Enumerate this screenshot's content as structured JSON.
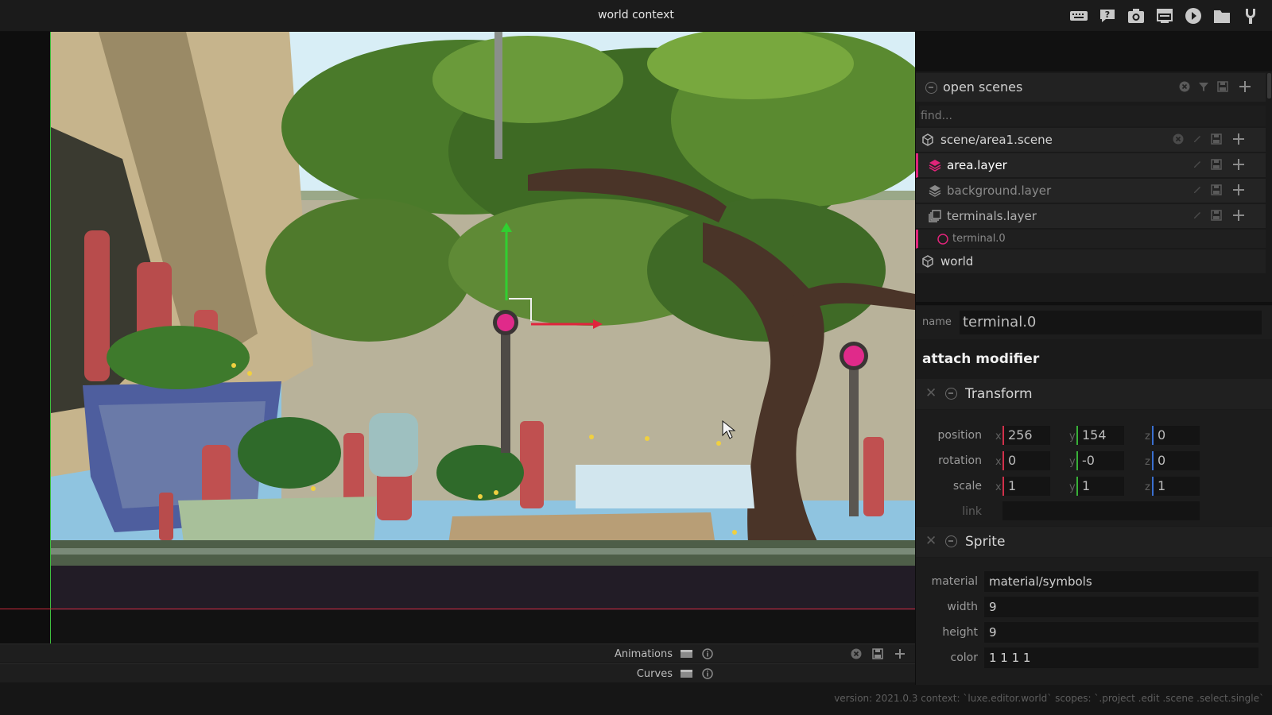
{
  "window": {
    "title": "world context"
  },
  "toolbar": {
    "icons": [
      "keyboard-icon",
      "help-icon",
      "camera-icon",
      "monitor-icon",
      "play-icon",
      "folder-icon",
      "settings-icon"
    ]
  },
  "open_scenes": {
    "title": "open scenes",
    "find_placeholder": "find...",
    "items": [
      {
        "label": "scene/area1.scene",
        "icon": "cube-icon"
      },
      {
        "label": "area.layer",
        "icon": "layers-icon"
      },
      {
        "label": "background.layer",
        "icon": "layers-icon"
      },
      {
        "label": "terminals.layer",
        "icon": "layers-icon"
      },
      {
        "label": "terminal.0",
        "icon": "circle-icon"
      },
      {
        "label": "world",
        "icon": "cube-icon"
      }
    ]
  },
  "inspector": {
    "name_label": "name",
    "name_value": "terminal.0",
    "attach_modifier": "attach modifier",
    "transform": {
      "title": "Transform",
      "position_label": "position",
      "rotation_label": "rotation",
      "scale_label": "scale",
      "link_label": "link",
      "axis_x": "x",
      "axis_y": "y",
      "axis_z": "z",
      "position": {
        "x": "256",
        "y": "154",
        "z": "0"
      },
      "rotation": {
        "x": "0",
        "y": "-0",
        "z": "0"
      },
      "scale": {
        "x": "1",
        "y": "1",
        "z": "1"
      },
      "link": ""
    },
    "sprite": {
      "title": "Sprite",
      "material_label": "material",
      "material": "material/symbols",
      "width_label": "width",
      "width": "9",
      "height_label": "height",
      "height": "9",
      "color_label": "color",
      "color": "1 1 1 1"
    }
  },
  "bottom": {
    "animations_label": "Animations",
    "curves_label": "Curves"
  },
  "status": {
    "text": "version: 2021.0.3 context: `luxe.editor.world` scopes: `.project .edit .scene .select.single`"
  },
  "colors": {
    "accent_pink": "#e0247a",
    "axis_red": "#e0243c",
    "axis_green": "#30d030",
    "axis_blue": "#3a70d0"
  }
}
